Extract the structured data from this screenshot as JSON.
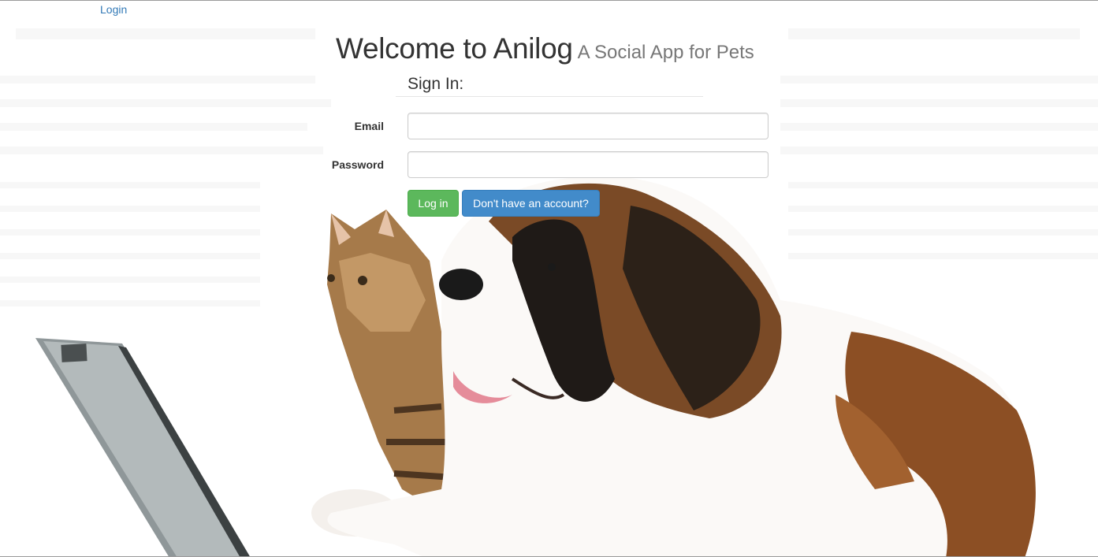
{
  "nav": {
    "login_link": "Login"
  },
  "header": {
    "title": "Welcome to Anilog",
    "subtitle": "A Social App for Pets"
  },
  "form": {
    "legend": "Sign In:",
    "email_label": "Email",
    "email_value": "",
    "password_label": "Password",
    "password_value": "",
    "login_button": "Log in",
    "signup_button": "Don't have an account?"
  },
  "colors": {
    "link": "#337ab7",
    "success_button": "#5cb85c",
    "primary_button": "#428bca"
  },
  "background": {
    "subjects": [
      "laptop",
      "cat",
      "dog"
    ]
  }
}
